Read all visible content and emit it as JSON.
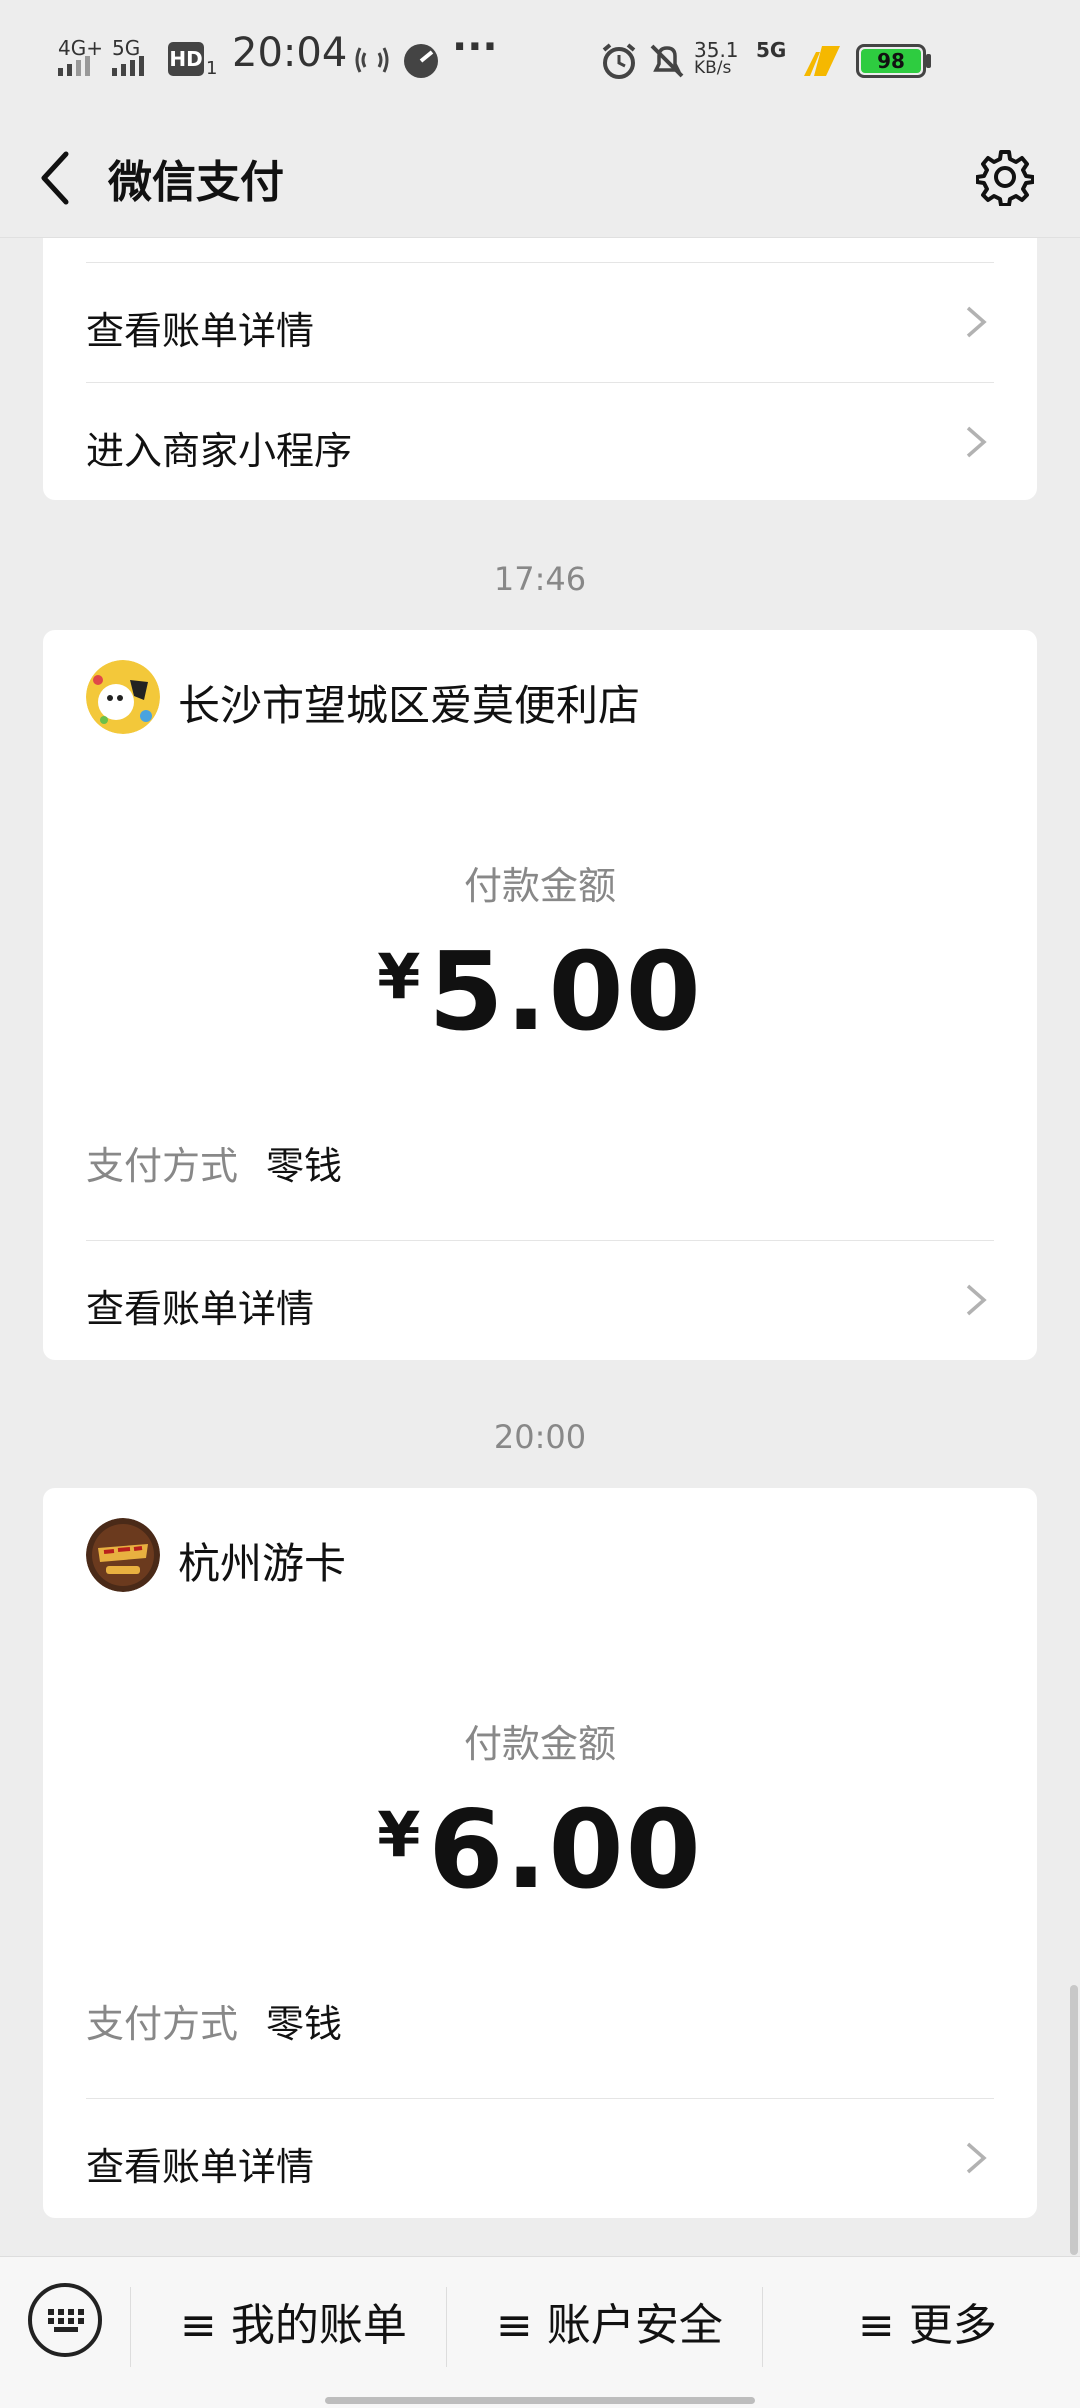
{
  "status_bar": {
    "time": "20:04",
    "network_left_1": "4G+",
    "network_left_2": "5G",
    "hd": "HD",
    "hd_sub": "1",
    "speed_value": "35.1",
    "speed_unit": "KB/s",
    "network_right": "5G",
    "battery": "98",
    "battery_color": "#2ecc40"
  },
  "nav": {
    "title": "微信支付"
  },
  "top_card": {
    "rows": [
      {
        "label": "查看账单详情"
      },
      {
        "label": "进入商家小程序"
      }
    ]
  },
  "transactions": [
    {
      "time": "17:46",
      "merchant": "长沙市望城区爱莫便利店",
      "amount_label": "付款金额",
      "currency": "¥",
      "amount": "5.00",
      "payment_method_key": "支付方式",
      "payment_method_value": "零钱",
      "detail_label": "查看账单详情"
    },
    {
      "time": "20:00",
      "merchant": "杭州游卡",
      "amount_label": "付款金额",
      "currency": "¥",
      "amount": "6.00",
      "payment_method_key": "支付方式",
      "payment_method_value": "零钱",
      "detail_label": "查看账单详情"
    }
  ],
  "bottom_bar": {
    "items": [
      {
        "label": "≡ 我的账单"
      },
      {
        "label": "≡ 账户安全"
      },
      {
        "label": "≡ 更多"
      }
    ]
  }
}
